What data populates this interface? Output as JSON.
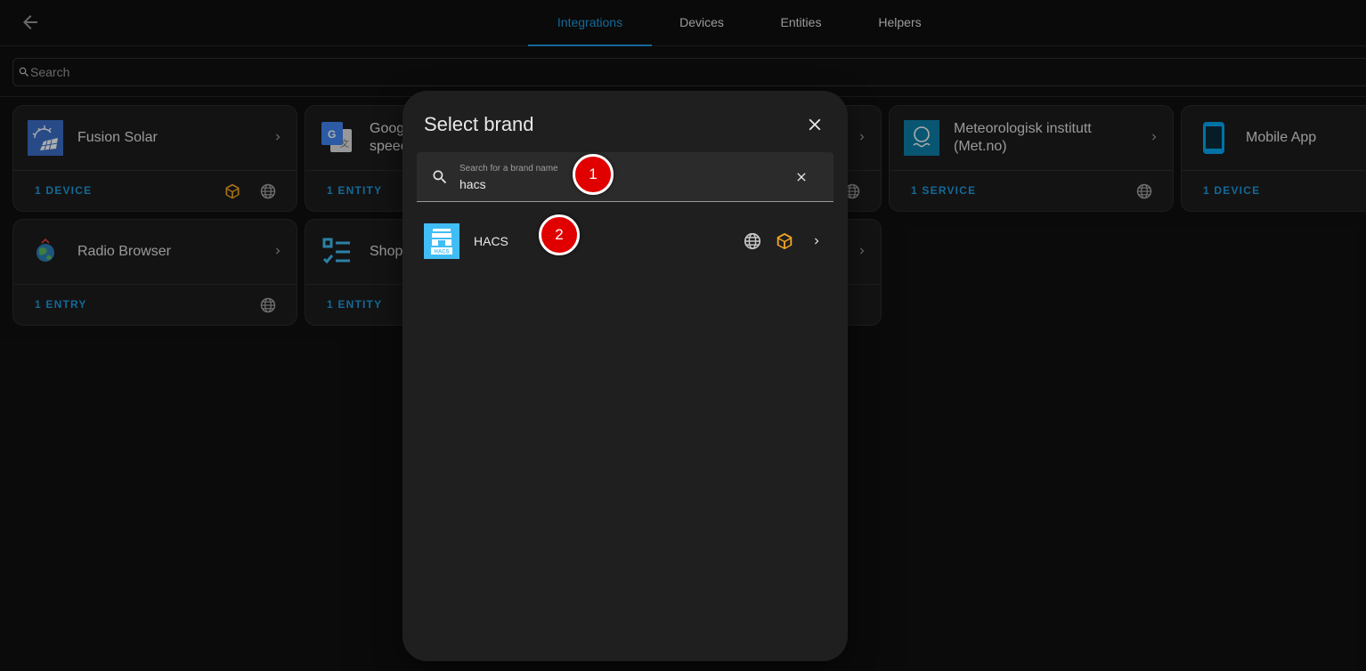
{
  "header": {
    "tabs": [
      {
        "label": "Integrations"
      },
      {
        "label": "Devices"
      },
      {
        "label": "Entities"
      },
      {
        "label": "Helpers"
      }
    ]
  },
  "search": {
    "placeholder": "Search",
    "value": ""
  },
  "cards": [
    {
      "name": "Fusion Solar",
      "count": "1 DEVICE"
    },
    {
      "name": "Goog speec",
      "count": "1 ENTITY"
    },
    {
      "name": "Meteorologisk institutt (Met.no)",
      "count": "1 SERVICE"
    },
    {
      "name": "Mobile App",
      "count": "1 DEVICE"
    },
    {
      "name": "Radio Browser",
      "count": "1 ENTRY"
    },
    {
      "name": "Shop",
      "count": "1 ENTITY"
    }
  ],
  "dialog": {
    "title": "Select brand",
    "search_label": "Search for a brand name",
    "search_value": "hacs",
    "results": [
      {
        "name": "HACS",
        "logo_text": "HACS"
      }
    ]
  },
  "markers": [
    "1",
    "2"
  ],
  "colors": {
    "accent": "#1e9be0",
    "custom_badge": "#f5a623",
    "marker": "#e10000",
    "hacs_brand": "#41bdf5"
  }
}
